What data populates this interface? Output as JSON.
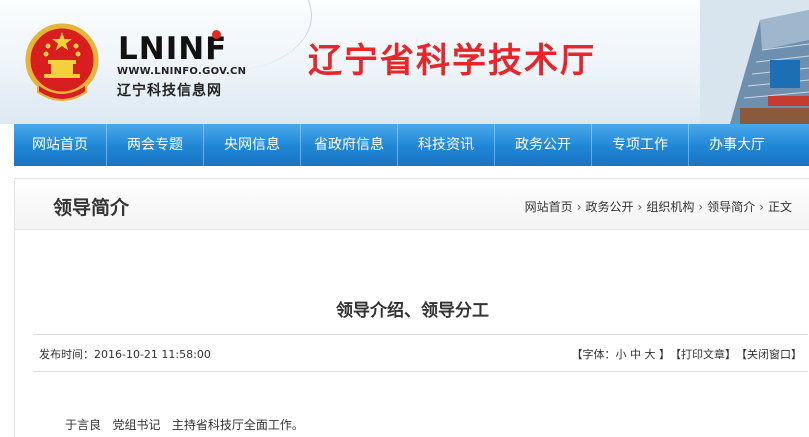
{
  "header": {
    "logo_word": "LNINF",
    "logo_url": "WWW.LNINFO.GOV.CN",
    "logo_name": "辽宁科技信息网",
    "site_title": "辽宁省科学技术厅"
  },
  "nav": {
    "items": [
      "网站首页",
      "两会专题",
      "央网信息",
      "省政府信息",
      "科技资讯",
      "政务公开",
      "专项工作",
      "办事大厅"
    ]
  },
  "panel": {
    "title": "领导简介",
    "breadcrumb": [
      "网站首页",
      "政务公开",
      "组织机构",
      "领导简介",
      "正文"
    ]
  },
  "article": {
    "title": "领导介绍、领导分工",
    "published_label": "发布时间：",
    "published_value": "2016-10-21 11:58:00",
    "font_open": "【字体：",
    "font_small": "小",
    "font_medium": "中",
    "font_large": "大",
    "font_close": " 】",
    "print": "【打印文章】",
    "close_window": "【关闭窗口】",
    "body_line1": "于言良   党组书记   主持省科技厅全面工作。"
  },
  "colors": {
    "brand_red": "#e8262a",
    "nav_blue": "#1f86d6"
  }
}
